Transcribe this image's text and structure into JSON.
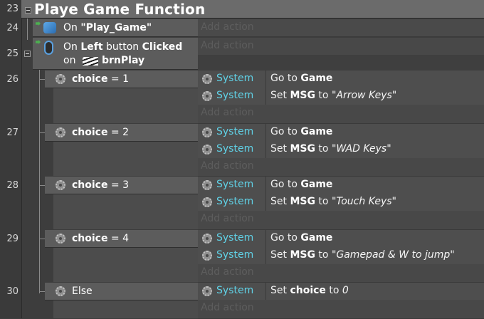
{
  "group": {
    "title": "Playe Game Function"
  },
  "line_numbers": [
    "23",
    "24",
    "25",
    "26",
    "27",
    "28",
    "29",
    "30"
  ],
  "events": {
    "e24": {
      "prefix": "On ",
      "layout": "\"Play_Game\"",
      "add_action": "Add action"
    },
    "e25": {
      "prefix": "On ",
      "button": "Left",
      "mid": " button ",
      "clicked": "Clicked",
      "line2": "on ",
      "object": "brnPlay",
      "add_action": "Add action"
    }
  },
  "subevents": [
    {
      "var": "choice",
      "op": " = 1",
      "actions": [
        {
          "object": "System",
          "verb": "Go to ",
          "target": "Game"
        },
        {
          "object": "System",
          "verb": "Set ",
          "target": "MSG",
          "to": " to ",
          "value": "\"Arrow Keys\""
        }
      ],
      "add_action": "Add action"
    },
    {
      "var": "choice",
      "op": " = 2",
      "actions": [
        {
          "object": "System",
          "verb": "Go to ",
          "target": "Game"
        },
        {
          "object": "System",
          "verb": "Set ",
          "target": "MSG",
          "to": " to ",
          "value": "\"WAD Keys\""
        }
      ],
      "add_action": "Add action"
    },
    {
      "var": "choice",
      "op": " = 3",
      "actions": [
        {
          "object": "System",
          "verb": "Go to ",
          "target": "Game"
        },
        {
          "object": "System",
          "verb": "Set ",
          "target": "MSG",
          "to": " to ",
          "value": "\"Touch Keys\""
        }
      ],
      "add_action": "Add action"
    },
    {
      "var": "choice",
      "op": " = 4",
      "actions": [
        {
          "object": "System",
          "verb": "Go to ",
          "target": "Game"
        },
        {
          "object": "System",
          "verb": "Set ",
          "target": "MSG",
          "to": " to ",
          "value": "\"Gamepad & W to jump\""
        }
      ],
      "add_action": "Add action"
    },
    {
      "label": "Else",
      "actions": [
        {
          "object": "System",
          "verb": "Set ",
          "target": "choice",
          "to": " to ",
          "value": "0"
        }
      ],
      "add_action": "Add action"
    }
  ],
  "colors": {
    "object_name": "#60d1e6",
    "add_action": "#5d5d5d"
  }
}
